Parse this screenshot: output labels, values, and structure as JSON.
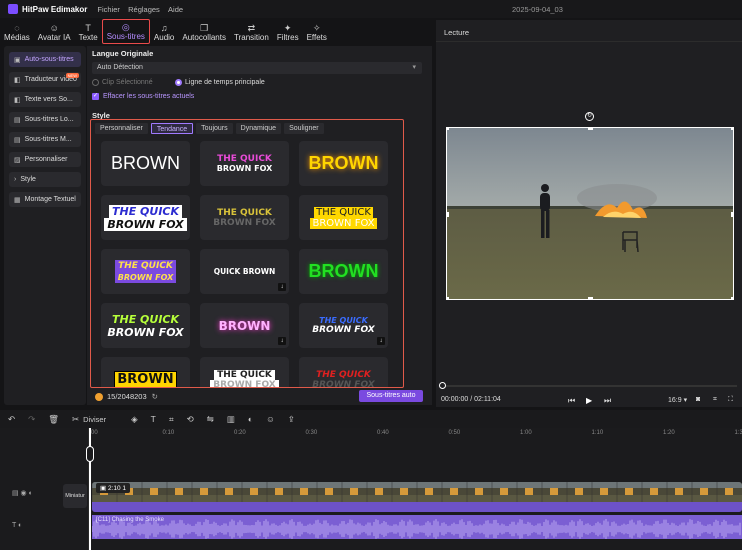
{
  "app": {
    "brand": "HitPaw Edimakor",
    "menus": [
      "Fichier",
      "Réglages",
      "Aide"
    ],
    "project": "2025-09-04_03"
  },
  "toolbar": [
    {
      "id": "medias",
      "label": "Médias",
      "icon": "◌"
    },
    {
      "id": "avatar",
      "label": "Avatar IA",
      "icon": "☺"
    },
    {
      "id": "texte",
      "label": "Texte",
      "icon": "T"
    },
    {
      "id": "soustitres",
      "label": "Sous-titres",
      "icon": "◎",
      "active": true
    },
    {
      "id": "audio",
      "label": "Audio",
      "icon": "♫"
    },
    {
      "id": "autocollants",
      "label": "Autocollants",
      "icon": "❒"
    },
    {
      "id": "transition",
      "label": "Transition",
      "icon": "⇄"
    },
    {
      "id": "filtres",
      "label": "Filtres",
      "icon": "✦"
    },
    {
      "id": "effets",
      "label": "Effets",
      "icon": "✧"
    }
  ],
  "sidebar": [
    {
      "label": "Auto-sous-titres",
      "icon": "▣",
      "active": true
    },
    {
      "label": "Traducteur vidéo",
      "icon": "◧",
      "badge": "NEW"
    },
    {
      "label": "Texte vers So...",
      "icon": "◧"
    },
    {
      "label": "Sous-titres Lo...",
      "icon": "▤"
    },
    {
      "label": "Sous-titres M...",
      "icon": "▤"
    },
    {
      "label": "Personnaliser",
      "icon": "▨"
    },
    {
      "label": "Style",
      "icon": "›"
    },
    {
      "label": "Montage Textuel",
      "icon": "▦"
    }
  ],
  "panel": {
    "lang_label": "Langue Originale",
    "lang_value": "Auto Détection",
    "radio1": "Clip Sélectionné",
    "radio2": "Ligne de temps principale",
    "checkbox": "Effacer les sous-titres actuels",
    "style_label": "Style",
    "tabs": [
      "Personnaliser",
      "Tendance",
      "Toujours",
      "Dynamique",
      "Souligner"
    ],
    "active_tab": "Tendance",
    "credits": "15/2048203",
    "auto_button": "Sous-titres auto"
  },
  "styles": [
    {
      "l1": "BROWN",
      "l2": "",
      "cls": "s1"
    },
    {
      "l1": "THE QUICK",
      "l2": "BROWN FOX",
      "cls": "s2"
    },
    {
      "l1": "BROWN",
      "l2": "",
      "cls": "s3"
    },
    {
      "l1": "THE QUICK",
      "l2": "BROWN FOX",
      "cls": "s4"
    },
    {
      "l1": "THE QUICK",
      "l2": "BROWN FOX",
      "cls": "s5"
    },
    {
      "l1": "THE QUICK",
      "l2": "BROWN FOX",
      "cls": "s6"
    },
    {
      "l1": "THE QUICK",
      "l2": "BROWN FOX",
      "cls": "s7"
    },
    {
      "l1": "QUICK BROWN",
      "l2": "",
      "cls": "s8",
      "dl": true
    },
    {
      "l1": "BROWN",
      "l2": "",
      "cls": "s9"
    },
    {
      "l1": "THE QUICK",
      "l2": "BROWN FOX",
      "cls": "s10"
    },
    {
      "l1": "BROWN",
      "l2": "",
      "cls": "s11",
      "dl": true
    },
    {
      "l1": "THE QUICK",
      "l2": "BROWN FOX",
      "cls": "s12",
      "dl": true
    },
    {
      "l1": "BROWN",
      "l2": "",
      "cls": "s13"
    },
    {
      "l1": "THE QUICK",
      "l2": "BROWN FOX",
      "cls": "s14"
    },
    {
      "l1": "THE QUICK",
      "l2": "BROWN FOX",
      "cls": "s15"
    }
  ],
  "preview": {
    "title": "Lecture",
    "time": "00:00:00 / 02:11:04",
    "ratio": "16:9"
  },
  "tools": {
    "split": "Diviser"
  },
  "timeline": {
    "ticks": [
      "00",
      "0:10",
      "0:20",
      "0:30",
      "0:40",
      "0:50",
      "1:00",
      "1:10",
      "1:20",
      "1:30"
    ],
    "clip_label": "2:10 1",
    "track_label": "Miniatur",
    "caption": "[C11] Chasing the Smoke"
  }
}
